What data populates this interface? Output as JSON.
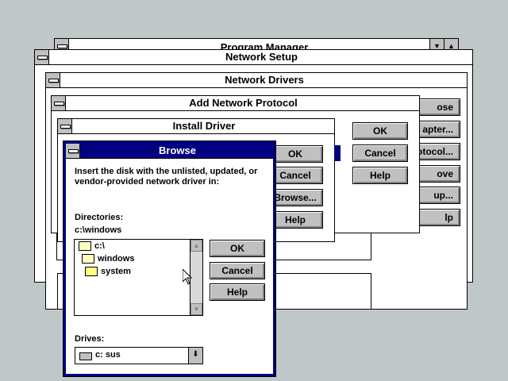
{
  "windows": {
    "program_manager": {
      "title": "Program Manager"
    },
    "network_setup": {
      "title": "Network Setup"
    },
    "network_drivers": {
      "title": "Network Drivers"
    },
    "add_network_protocol": {
      "title": "Add Network Protocol"
    },
    "install_driver": {
      "title": "Install Driver"
    },
    "browse": {
      "title": "Browse"
    }
  },
  "background_buttons": {
    "network_drivers_buttons": [
      "ose",
      "apter...",
      "otocol...",
      "ove",
      "up...",
      "lp"
    ],
    "add_protocol_buttons": [
      "OK",
      "Cancel",
      "Help"
    ],
    "install_driver_buttons": [
      "OK",
      "Cancel",
      "Browse...",
      "Help"
    ]
  },
  "browse": {
    "instruction": "Insert the disk with the unlisted, updated, or vendor-provided network driver in:",
    "directories_label": "Directories:",
    "current_path": "c:\\windows",
    "tree": [
      {
        "label": "c:\\",
        "icon": "open-folder-icon"
      },
      {
        "label": "windows",
        "icon": "open-folder-icon"
      },
      {
        "label": "system",
        "icon": "folder-icon"
      }
    ],
    "drives_label": "Drives:",
    "drive_selected": "c: sus",
    "buttons": {
      "ok": "OK",
      "cancel": "Cancel",
      "help": "Help"
    }
  },
  "colors": {
    "active_title": "#000080",
    "desktop": "#c0c7c8"
  }
}
